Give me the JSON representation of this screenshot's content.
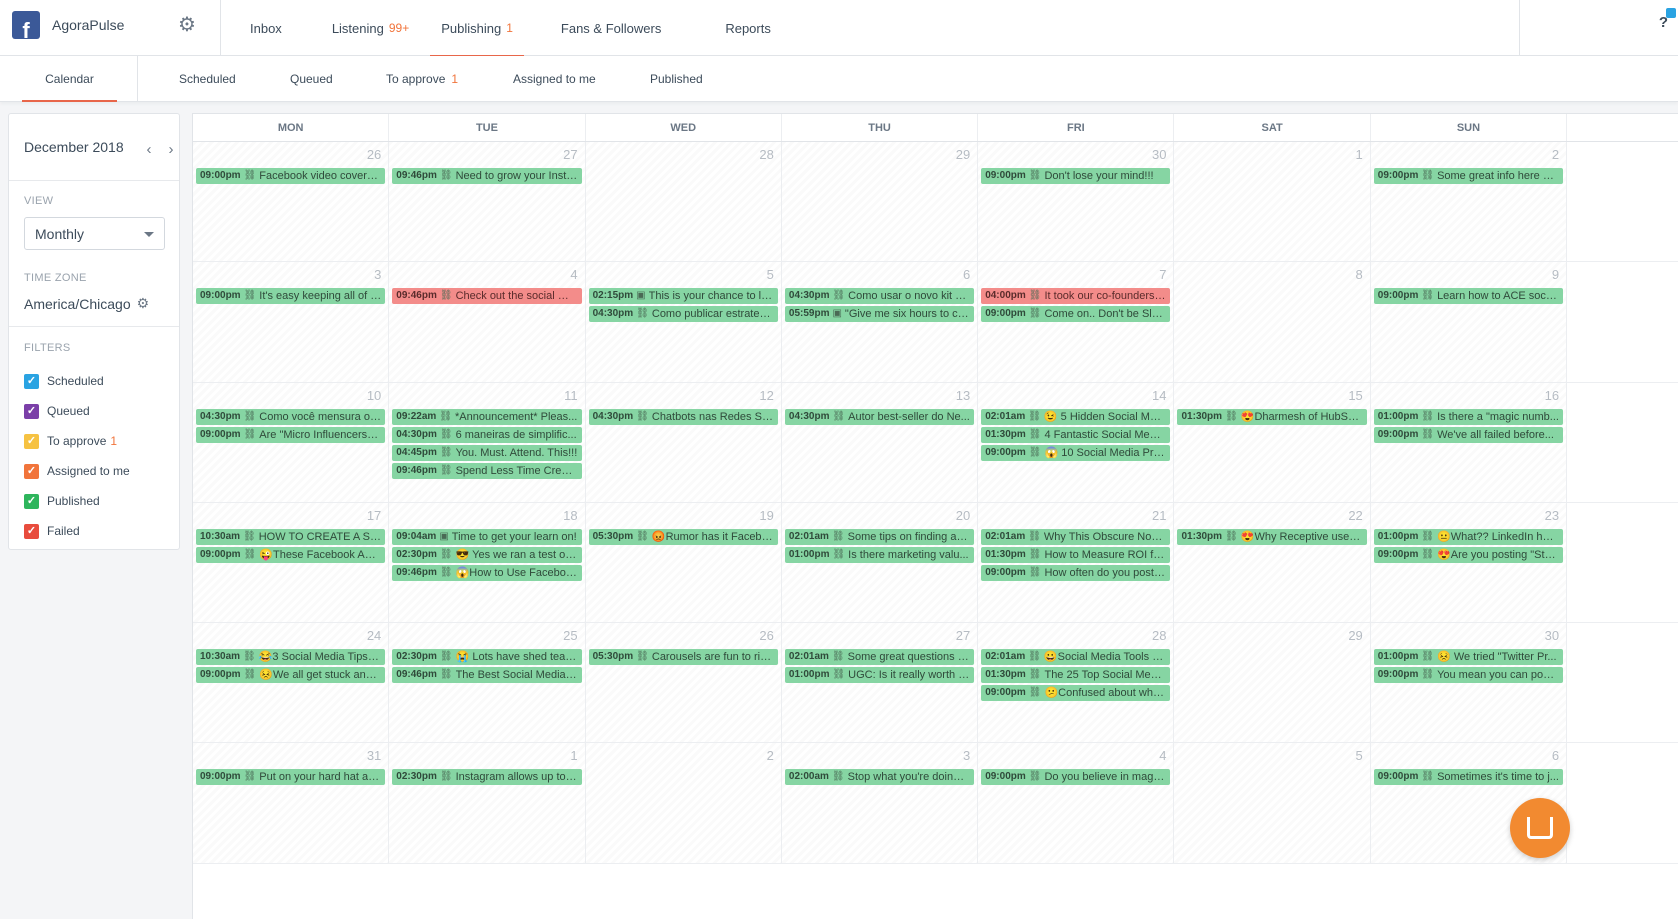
{
  "brand": {
    "name": "AgoraPulse",
    "logo_letter": "f",
    "icon": "facebook-icon"
  },
  "nav": [
    {
      "label": "Inbox",
      "count": ""
    },
    {
      "label": "Listening",
      "count": "99+"
    },
    {
      "label": "Publishing",
      "count": "1"
    },
    {
      "label": "Fans & Followers",
      "count": ""
    },
    {
      "label": "Reports",
      "count": ""
    }
  ],
  "nav_active": "Publishing",
  "help": "?",
  "subnav": [
    {
      "label": "Calendar",
      "count": ""
    },
    {
      "label": "Scheduled",
      "count": ""
    },
    {
      "label": "Queued",
      "count": ""
    },
    {
      "label": "To approve",
      "count": "1"
    },
    {
      "label": "Assigned to me",
      "count": ""
    },
    {
      "label": "Published",
      "count": ""
    }
  ],
  "subnav_active": "Calendar",
  "sidebar": {
    "month": "December 2018",
    "view_label": "VIEW",
    "view_value": "Monthly",
    "tz_label": "TIME ZONE",
    "tz_value": "America/Chicago",
    "filters_label": "FILTERS",
    "filters": [
      {
        "label": "Scheduled",
        "count": "",
        "color": "#2aa3e2"
      },
      {
        "label": "Queued",
        "count": "",
        "color": "#7b3fa8"
      },
      {
        "label": "To approve",
        "count": "1",
        "color": "#f6c242"
      },
      {
        "label": "Assigned to me",
        "count": "",
        "color": "#f1743b"
      },
      {
        "label": "Published",
        "count": "",
        "color": "#2eb55c"
      },
      {
        "label": "Failed",
        "count": "",
        "color": "#e84c3d"
      }
    ]
  },
  "calendar": {
    "days_of_week": [
      "MON",
      "TUE",
      "WED",
      "THU",
      "FRI",
      "SAT",
      "SUN"
    ],
    "weeks": [
      [
        {
          "day": "26",
          "posts": [
            {
              "time": "09:00pm",
              "icon": "link",
              "text": "Facebook video covers a..."
            }
          ]
        },
        {
          "day": "27",
          "posts": [
            {
              "time": "09:46pm",
              "icon": "link",
              "text": "Need to grow your Insta..."
            }
          ]
        },
        {
          "day": "28",
          "posts": []
        },
        {
          "day": "29",
          "posts": []
        },
        {
          "day": "30",
          "posts": [
            {
              "time": "09:00pm",
              "icon": "link",
              "text": "Don't lose your mind!!!"
            }
          ]
        },
        {
          "day": "1",
          "posts": []
        },
        {
          "day": "2",
          "posts": [
            {
              "time": "09:00pm",
              "icon": "link",
              "text": "Some great info here on..."
            }
          ]
        }
      ],
      [
        {
          "day": "3",
          "posts": [
            {
              "time": "09:00pm",
              "icon": "link",
              "text": "It's easy keeping all of t..."
            }
          ]
        },
        {
          "day": "4",
          "posts": [
            {
              "time": "09:46pm",
              "icon": "link",
              "text": "Check out the social me...",
              "status": "failed"
            }
          ]
        },
        {
          "day": "5",
          "posts": [
            {
              "time": "02:15pm",
              "icon": "image",
              "text": "This is your chance to le..."
            },
            {
              "time": "04:30pm",
              "icon": "link",
              "text": "Como publicar estrategi..."
            }
          ]
        },
        {
          "day": "6",
          "posts": [
            {
              "time": "04:30pm",
              "icon": "link",
              "text": "Como usar o novo kit de..."
            },
            {
              "time": "05:59pm",
              "icon": "image",
              "text": "\"Give me six hours to ch..."
            }
          ]
        },
        {
          "day": "7",
          "posts": [
            {
              "time": "04:00pm",
              "icon": "link",
              "text": "It took our co-founders, ...",
              "status": "failed"
            },
            {
              "time": "09:00pm",
              "icon": "link",
              "text": "Come on.. Don't be Slea..."
            }
          ]
        },
        {
          "day": "8",
          "posts": []
        },
        {
          "day": "9",
          "posts": [
            {
              "time": "09:00pm",
              "icon": "link",
              "text": "Learn how to ACE social ..."
            }
          ]
        }
      ],
      [
        {
          "day": "10",
          "posts": [
            {
              "time": "04:30pm",
              "icon": "link",
              "text": "Como você mensura o s..."
            },
            {
              "time": "09:00pm",
              "icon": "link",
              "text": "Are \"Micro Influencers\" ..."
            }
          ]
        },
        {
          "day": "11",
          "posts": [
            {
              "time": "09:22am",
              "icon": "link",
              "text": "*Announcement* Pleas..."
            },
            {
              "time": "04:30pm",
              "icon": "link",
              "text": "6 maneiras de simplific..."
            },
            {
              "time": "04:45pm",
              "icon": "link",
              "text": "You. Must. Attend. This!!!"
            },
            {
              "time": "09:46pm",
              "icon": "link",
              "text": "Spend Less Time Creati..."
            }
          ]
        },
        {
          "day": "12",
          "posts": [
            {
              "time": "04:30pm",
              "icon": "link",
              "text": "Chatbots nas Redes Soci..."
            }
          ]
        },
        {
          "day": "13",
          "posts": [
            {
              "time": "04:30pm",
              "icon": "link",
              "text": "Autor best-seller do Ne..."
            }
          ]
        },
        {
          "day": "14",
          "posts": [
            {
              "time": "02:01am",
              "icon": "link",
              "text": "😉 5 Hidden Social Medi..."
            },
            {
              "time": "01:30pm",
              "icon": "link",
              "text": "4 Fantastic Social Media..."
            },
            {
              "time": "09:00pm",
              "icon": "link",
              "text": "😱 10 Social Media Pred..."
            }
          ]
        },
        {
          "day": "15",
          "posts": [
            {
              "time": "01:30pm",
              "icon": "link",
              "text": "😍Dharmesh of HubSpo..."
            }
          ]
        },
        {
          "day": "16",
          "posts": [
            {
              "time": "01:00pm",
              "icon": "link",
              "text": "Is there a \"magic numb..."
            },
            {
              "time": "09:00pm",
              "icon": "link",
              "text": "We've all failed before..."
            }
          ]
        }
      ],
      [
        {
          "day": "17",
          "posts": [
            {
              "time": "10:30am",
              "icon": "link",
              "text": "HOW TO CREATE A SMA..."
            },
            {
              "time": "09:00pm",
              "icon": "link",
              "text": "😜These Facebook Ad t..."
            }
          ]
        },
        {
          "day": "18",
          "posts": [
            {
              "time": "09:04am",
              "icon": "image",
              "text": "Time to get your learn on!"
            },
            {
              "time": "02:30pm",
              "icon": "link",
              "text": "😎 Yes we ran a test on ..."
            },
            {
              "time": "09:46pm",
              "icon": "link",
              "text": "😱How to Use Faceboo..."
            }
          ]
        },
        {
          "day": "19",
          "posts": [
            {
              "time": "05:30pm",
              "icon": "link",
              "text": "😡Rumor has it Facebo..."
            }
          ]
        },
        {
          "day": "20",
          "posts": [
            {
              "time": "02:01am",
              "icon": "link",
              "text": "Some tips on finding a g..."
            },
            {
              "time": "01:00pm",
              "icon": "link",
              "text": "Is there marketing valu..."
            }
          ]
        },
        {
          "day": "21",
          "posts": [
            {
              "time": "02:01am",
              "icon": "link",
              "text": "Why This Obscure Nonp..."
            },
            {
              "time": "01:30pm",
              "icon": "link",
              "text": "How to Measure ROI fro..."
            },
            {
              "time": "09:00pm",
              "icon": "link",
              "text": "How often do you post t..."
            }
          ]
        },
        {
          "day": "22",
          "posts": [
            {
              "time": "01:30pm",
              "icon": "link",
              "text": "😍Why Receptive uses ..."
            }
          ]
        },
        {
          "day": "23",
          "posts": [
            {
              "time": "01:00pm",
              "icon": "link",
              "text": "😐What?? LinkedIn has ..."
            },
            {
              "time": "09:00pm",
              "icon": "link",
              "text": "😍Are you posting \"Stor..."
            }
          ]
        }
      ],
      [
        {
          "day": "24",
          "posts": [
            {
              "time": "10:30am",
              "icon": "link",
              "text": "😂3 Social Media Tips to..."
            },
            {
              "time": "09:00pm",
              "icon": "link",
              "text": "😣We all get stuck and ..."
            }
          ]
        },
        {
          "day": "25",
          "posts": [
            {
              "time": "02:30pm",
              "icon": "link",
              "text": "😭 Lots have shed tears..."
            },
            {
              "time": "09:46pm",
              "icon": "link",
              "text": "The Best Social Media A..."
            }
          ]
        },
        {
          "day": "26",
          "posts": [
            {
              "time": "05:30pm",
              "icon": "link",
              "text": "Carousels are fun to rid..."
            }
          ]
        },
        {
          "day": "27",
          "posts": [
            {
              "time": "02:01am",
              "icon": "link",
              "text": "Some great questions to..."
            },
            {
              "time": "01:00pm",
              "icon": "link",
              "text": "UGC: Is it really worth th..."
            }
          ]
        },
        {
          "day": "28",
          "posts": [
            {
              "time": "02:01am",
              "icon": "link",
              "text": "😀Social Media Tools Fo..."
            },
            {
              "time": "01:30pm",
              "icon": "link",
              "text": "The 25 Top Social Media..."
            },
            {
              "time": "09:00pm",
              "icon": "link",
              "text": "😕Confused about wha..."
            }
          ]
        },
        {
          "day": "29",
          "posts": []
        },
        {
          "day": "30",
          "posts": [
            {
              "time": "01:00pm",
              "icon": "link",
              "text": "😣 We tried \"Twitter Pr..."
            },
            {
              "time": "09:00pm",
              "icon": "link",
              "text": "You mean you can post ..."
            }
          ]
        }
      ],
      [
        {
          "day": "31",
          "posts": [
            {
              "time": "09:00pm",
              "icon": "link",
              "text": "Put on your hard hat an..."
            }
          ]
        },
        {
          "day": "1",
          "posts": [
            {
              "time": "02:30pm",
              "icon": "link",
              "text": "Instagram allows up to ..."
            }
          ]
        },
        {
          "day": "2",
          "posts": []
        },
        {
          "day": "3",
          "posts": [
            {
              "time": "02:00am",
              "icon": "link",
              "text": "Stop what you're doing ..."
            }
          ]
        },
        {
          "day": "4",
          "posts": [
            {
              "time": "09:00pm",
              "icon": "link",
              "text": "Do you believe in magic??"
            }
          ]
        },
        {
          "day": "5",
          "posts": []
        },
        {
          "day": "6",
          "posts": [
            {
              "time": "09:00pm",
              "icon": "link",
              "text": "Sometimes it's time to j..."
            }
          ]
        }
      ]
    ]
  },
  "colors": {
    "accent": "#e8664a",
    "count": "#f1743b",
    "post_published": "#86d5a3",
    "post_failed": "#f38c8a",
    "chat": "#f28a30"
  }
}
